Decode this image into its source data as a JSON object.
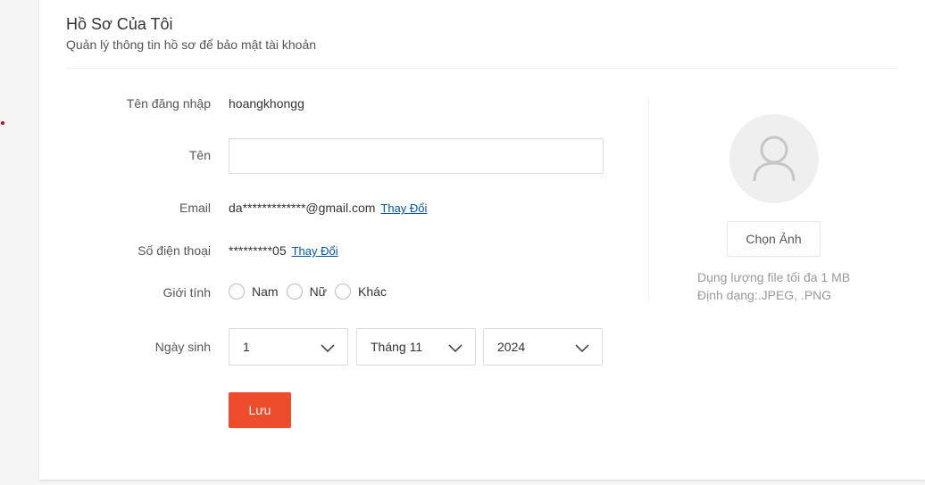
{
  "header": {
    "title": "Hồ Sơ Của Tôi",
    "subtitle": "Quản lý thông tin hồ sơ để bảo mật tài khoản"
  },
  "form": {
    "username": {
      "label": "Tên đăng nhập",
      "value": "hoangkhongg"
    },
    "name": {
      "label": "Tên",
      "value": ""
    },
    "email": {
      "label": "Email",
      "value": "da*************@gmail.com",
      "change_label": "Thay Đổi"
    },
    "phone": {
      "label": "Số điện thoại",
      "value": "*********05",
      "change_label": "Thay Đổi"
    },
    "gender": {
      "label": "Giới tính",
      "options": [
        "Nam",
        "Nữ",
        "Khác"
      ],
      "selected": null
    },
    "birthday": {
      "label": "Ngày sinh",
      "day": "1",
      "month": "Tháng 11",
      "year": "2024"
    },
    "save_label": "Lưu"
  },
  "avatar": {
    "icon": "user-icon",
    "choose_label": "Chọn Ảnh",
    "max_size_text": "Dụng lượng file tối đa 1 MB",
    "format_text": "Định dạng:.JPEG, .PNG"
  },
  "colors": {
    "accent": "#ee4d2d",
    "link": "#0055aa"
  }
}
